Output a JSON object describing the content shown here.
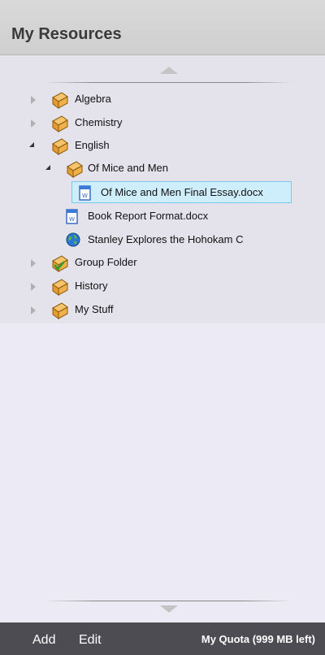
{
  "header": {
    "title": "My Resources"
  },
  "tree": {
    "items": [
      {
        "label": "Algebra"
      },
      {
        "label": "Chemistry"
      },
      {
        "label": "English"
      },
      {
        "label": "Of Mice and Men"
      },
      {
        "label": "Of Mice and Men Final Essay.docx"
      },
      {
        "label": "Book Report Format.docx"
      },
      {
        "label": "Stanley Explores the Hohokam C"
      },
      {
        "label": "Group Folder"
      },
      {
        "label": "History"
      },
      {
        "label": "My Stuff"
      }
    ]
  },
  "footer": {
    "add_label": "Add",
    "edit_label": "Edit",
    "quota_text": "My Quota (999 MB left)"
  },
  "colors": {
    "header_bg": "#d4d4d4",
    "panel_bg": "#e4e3ec",
    "selection_bg": "#cfeefc",
    "selection_border": "#79c7ea",
    "footer_bg": "#4c4c52"
  }
}
